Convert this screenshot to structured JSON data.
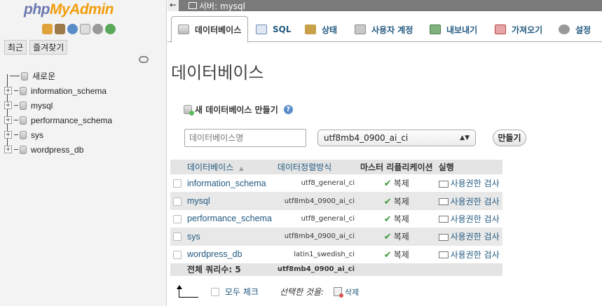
{
  "nav": {
    "logo_php": "php",
    "logo_myadmin": "MyAdmin",
    "tabs": [
      "최근",
      "즐겨찾기"
    ],
    "tree": [
      {
        "label": "새로운",
        "type": "new"
      },
      {
        "label": "information_schema",
        "type": "db"
      },
      {
        "label": "mysql",
        "type": "db"
      },
      {
        "label": "performance_schema",
        "type": "db"
      },
      {
        "label": "sys",
        "type": "db"
      },
      {
        "label": "wordpress_db",
        "type": "db"
      }
    ]
  },
  "topbar": {
    "back": "←",
    "server": "서버: mysql"
  },
  "menu": [
    {
      "label": "데이터베이스",
      "icon": "database-icon",
      "active": true
    },
    {
      "label": "SQL",
      "icon": "sql-icon"
    },
    {
      "label": "상태",
      "icon": "status-icon"
    },
    {
      "label": "사용자 계정",
      "icon": "users-icon"
    },
    {
      "label": "내보내기",
      "icon": "export-icon"
    },
    {
      "label": "가져오기",
      "icon": "import-icon"
    },
    {
      "label": "설정",
      "icon": "settings-icon"
    }
  ],
  "page_title": "데이터베이스",
  "create": {
    "label": "새 데이터베이스 만들기",
    "help": "?",
    "name_placeholder": "데이터베이스명",
    "collation": "utf8mb4_0900_ai_ci",
    "button": "만들기"
  },
  "table": {
    "headers": [
      "데이터베이스",
      "데이터정렬방식",
      "마스터 리플리케이션",
      "실행"
    ],
    "rows": [
      {
        "name": "information_schema",
        "collation": "utf8_general_ci",
        "replication": "복제",
        "action": "사용권한 검사"
      },
      {
        "name": "mysql",
        "collation": "utf8mb4_0900_ai_ci",
        "replication": "복제",
        "action": "사용권한 검사"
      },
      {
        "name": "performance_schema",
        "collation": "utf8_general_ci",
        "replication": "복제",
        "action": "사용권한 검사"
      },
      {
        "name": "sys",
        "collation": "utf8mb4_0900_ai_ci",
        "replication": "복제",
        "action": "사용권한 검사"
      },
      {
        "name": "wordpress_db",
        "collation": "latin1_swedish_ci",
        "replication": "복제",
        "action": "사용권한 검사"
      }
    ],
    "total_label": "전체 쿼리수: 5",
    "total_collation": "utf8mb4_0900_ai_ci"
  },
  "footer": {
    "check_all": "모두 체크",
    "with_selected": "선택한 것을:",
    "delete": "삭제"
  },
  "colors": {
    "link": "#235a81",
    "logo_php": "#6c78af",
    "logo_myadmin": "#f29d0a"
  }
}
